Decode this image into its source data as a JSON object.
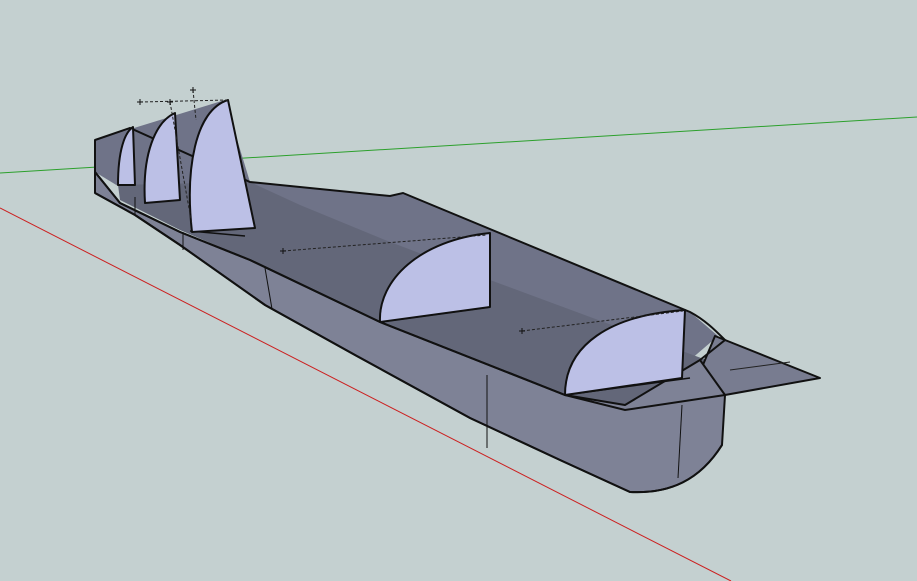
{
  "viewport": {
    "background": "#c4d0d0"
  },
  "axes": {
    "green_axis_color": "#2ca02c",
    "red_axis_color": "#cc1f1f"
  },
  "colors": {
    "hull_side": "#7e8296",
    "hull_dark": "#6b6f84",
    "deck_floor": "#676b80",
    "bulkhead_face": "#bcc0e6",
    "edge": "#111111",
    "guide": "#222222"
  }
}
